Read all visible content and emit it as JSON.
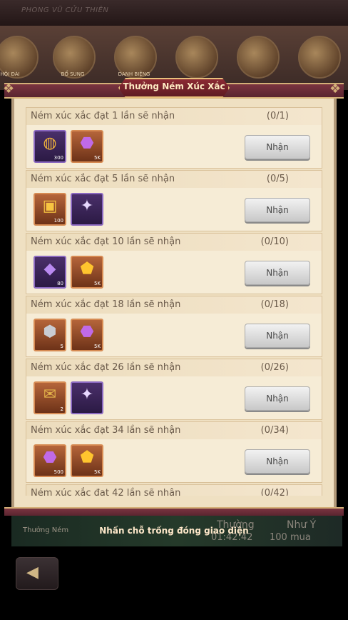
{
  "header": {
    "game_name": "PHONG VŨ CỬU THIÊN"
  },
  "background_nav": [
    {
      "label": "HỘI ĐÀI"
    },
    {
      "label": "BỔ SUNG"
    },
    {
      "label": "DANH BIỆNG"
    },
    {
      "label": ""
    },
    {
      "label": ""
    },
    {
      "label": ""
    }
  ],
  "dialog": {
    "title": "Thưởng Ném Xúc Xắc",
    "tap_hint": "Nhấn chỗ trống đóng giao diện",
    "claim_label": "Nhận",
    "rows": [
      {
        "requirement": "Ném xúc xắc đạt 1 lần sẽ nhận",
        "progress": "(0/1)",
        "rewards": [
          {
            "icon": "treasure-ring-icon",
            "qty": "300",
            "color": "purple"
          },
          {
            "icon": "purple-gem-icon",
            "qty": "5K",
            "color": "orange"
          }
        ]
      },
      {
        "requirement": "Ném xúc xắc đạt 5 lần sẽ nhận",
        "progress": "(0/5)",
        "rewards": [
          {
            "icon": "gem-chest-icon",
            "qty": "100",
            "color": "orange"
          },
          {
            "icon": "star-orb-icon",
            "qty": "",
            "color": "purple"
          }
        ]
      },
      {
        "requirement": "Ném xúc xắc đạt 10 lần sẽ nhận",
        "progress": "(0/10)",
        "rewards": [
          {
            "icon": "crystal-shard-icon",
            "qty": "80",
            "color": "purple"
          },
          {
            "icon": "gold-nugget-icon",
            "qty": "5K",
            "color": "orange"
          }
        ]
      },
      {
        "requirement": "Ném xúc xắc đạt 18 lần sẽ nhận",
        "progress": "(0/18)",
        "rewards": [
          {
            "icon": "iron-ore-icon",
            "qty": "5",
            "color": "orange"
          },
          {
            "icon": "purple-gem-icon",
            "qty": "5K",
            "color": "orange"
          }
        ]
      },
      {
        "requirement": "Ném xúc xắc đạt 26 lần sẽ nhận",
        "progress": "(0/26)",
        "rewards": [
          {
            "icon": "scroll-icon",
            "qty": "2",
            "color": "orange"
          },
          {
            "icon": "star-orb-icon",
            "qty": "",
            "color": "purple"
          }
        ]
      },
      {
        "requirement": "Ném xúc xắc đạt 34 lần sẽ nhận",
        "progress": "(0/34)",
        "rewards": [
          {
            "icon": "purple-gem-icon",
            "qty": "500",
            "color": "orange"
          },
          {
            "icon": "gold-nugget-icon",
            "qty": "5K",
            "color": "orange"
          }
        ]
      },
      {
        "requirement": "Ném xúc xắc đạt 42 lần sẽ nhận",
        "progress": "(0/42)",
        "rewards": []
      }
    ]
  },
  "background_lower": {
    "left_label": "Thưởng Ném",
    "mid_label": "Thường",
    "timer": "01:42:42",
    "right_label": "Như Ý",
    "price": "100 mua"
  },
  "back_button": {
    "icon": "back-arrow-icon"
  }
}
